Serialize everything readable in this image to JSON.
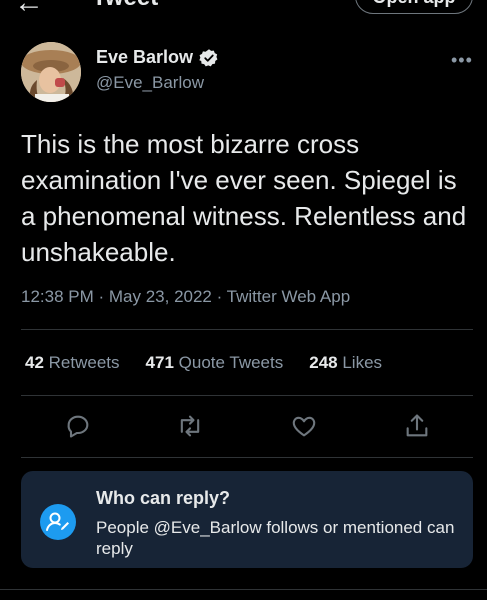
{
  "header": {
    "title": "Tweet",
    "open_app_label": "Open app"
  },
  "author": {
    "name": "Eve Barlow",
    "handle": "@Eve_Barlow",
    "verified": true
  },
  "tweet": {
    "text": "This is the most bizarre cross examination I've ever seen. Spiegel is a phenomenal witness. Relentless and unshakeable.",
    "timestamp": "12:38 PM · May 23, 2022 · Twitter Web App"
  },
  "stats": {
    "retweets_count": "42",
    "retweets_label": "Retweets",
    "quotes_count": "471",
    "quotes_label": "Quote Tweets",
    "likes_count": "248",
    "likes_label": "Likes"
  },
  "actions": [
    "reply-icon",
    "retweet-icon",
    "like-icon",
    "share-icon"
  ],
  "reply_settings": {
    "heading": "Who can reply?",
    "description": "People @Eve_Barlow follows or mentioned can reply"
  },
  "colors": {
    "background": "#000000",
    "text": "#e7e9ea",
    "muted": "#8b98a5",
    "accent": "#1d9bf0",
    "card": "#172436"
  }
}
